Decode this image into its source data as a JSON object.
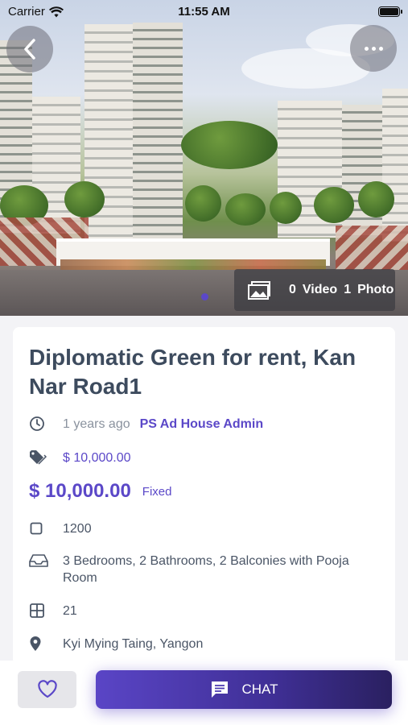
{
  "status_bar": {
    "carrier": "Carrier",
    "time": "11:55 AM"
  },
  "hero": {
    "media_count_video": "0",
    "media_label_video": "Video",
    "media_count_photo": "1",
    "media_label_photo": "Photo",
    "page_dots": 1,
    "active_dot": 0
  },
  "listing": {
    "title": "Diplomatic Green for rent, Kan Nar Road1",
    "posted_ago": "1 years ago",
    "posted_by": "PS Ad House Admin",
    "price_small": "$ 10,000.00",
    "price_big": "$ 10,000.00",
    "price_type": "Fixed",
    "area": "1200",
    "rooms": "3 Bedrooms, 2 Bathrooms, 2 Balconies with Pooja Room",
    "floor": "21",
    "location": "Kyi Mying Taing, Yangon"
  },
  "actions": {
    "chat_label": "CHAT"
  },
  "colors": {
    "accent": "#5b48c8",
    "text": "#3d4b5e",
    "muted": "#8a929e"
  },
  "icons": {
    "back": "chevron-left-icon",
    "more": "more-horizontal-icon",
    "media": "gallery-icon",
    "time": "clock-icon",
    "price": "price-tag-icon",
    "area": "square-icon",
    "rooms": "inbox-icon",
    "floor": "grid-icon",
    "location": "location-pin-icon",
    "favorite": "heart-icon",
    "chat": "chat-bubble-icon"
  }
}
